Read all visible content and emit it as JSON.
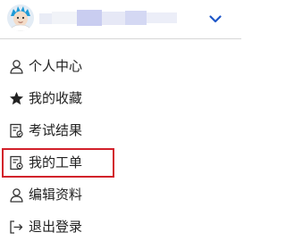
{
  "header": {
    "avatar_icon": "user-avatar-icon",
    "username_obscured": true,
    "chevron_icon": "chevron-down-icon",
    "accent_color": "#1f57c8"
  },
  "menu": {
    "items": [
      {
        "label": "个人中心",
        "icon": "user-outline-icon"
      },
      {
        "label": "我的收藏",
        "icon": "star-filled-icon"
      },
      {
        "label": "考试结果",
        "icon": "exam-result-icon"
      },
      {
        "label": "我的工单",
        "icon": "ticket-document-icon",
        "highlighted": true
      },
      {
        "label": "编辑资料",
        "icon": "user-outline-icon"
      },
      {
        "label": "退出登录",
        "icon": "logout-icon"
      }
    ],
    "highlight_color": "#d21f2a"
  }
}
